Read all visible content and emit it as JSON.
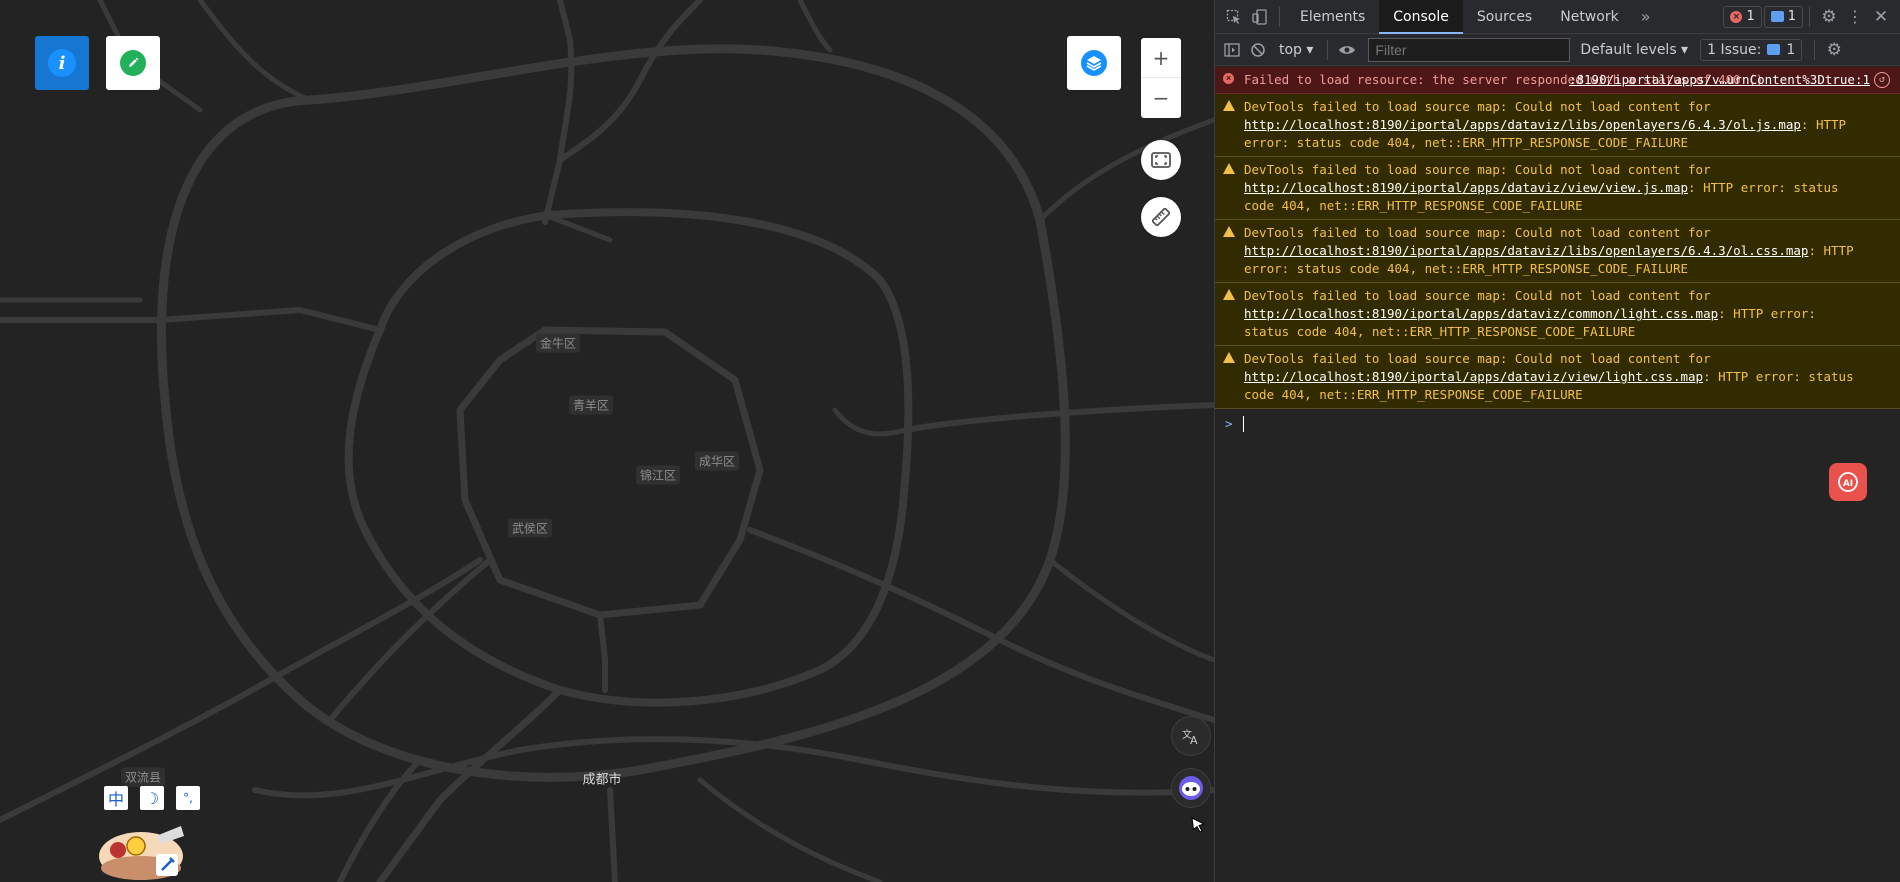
{
  "map": {
    "districts": [
      {
        "id": "jinniu",
        "label": "金牛区"
      },
      {
        "id": "qingyang",
        "label": "青羊区"
      },
      {
        "id": "chenghua",
        "label": "成华区"
      },
      {
        "id": "jinjiang",
        "label": "锦江区"
      },
      {
        "id": "wuhou",
        "label": "武侯区"
      },
      {
        "id": "shuangliu",
        "label": "双流县"
      }
    ],
    "city_label": "成都市",
    "zoom_in_label": "+",
    "zoom_out_label": "−",
    "ime_keys": [
      "中",
      "☽",
      "°,"
    ]
  },
  "devtools": {
    "tabs": [
      "Elements",
      "Console",
      "Sources",
      "Network"
    ],
    "active_tab": "Console",
    "more_tabs": "»",
    "error_count": "1",
    "message_count": "1",
    "context": "top ▾",
    "filter_placeholder": "Filter",
    "levels": "Default levels ▾",
    "issues_label": "1 Issue:",
    "issues_count": "1",
    "messages": [
      {
        "level": "error",
        "text": "Failed to load resource: the server responded with a status of 400 ()",
        "source": ":8190/iportal/apps/v…urnContent%3Dtrue:1"
      },
      {
        "level": "warning",
        "prefix": "DevTools failed to load source map: Could not load content for ",
        "url": "http://localhost:8190/iportal/apps/dataviz/libs/openlayers/6.4.3/ol.js.map",
        "suffix": ": HTTP error: status code 404, net::ERR_HTTP_RESPONSE_CODE_FAILURE"
      },
      {
        "level": "warning",
        "prefix": "DevTools failed to load source map: Could not load content for ",
        "url": "http://localhost:8190/iportal/apps/dataviz/view/view.js.map",
        "suffix": ": HTTP error: status code 404, net::ERR_HTTP_RESPONSE_CODE_FAILURE"
      },
      {
        "level": "warning",
        "prefix": "DevTools failed to load source map: Could not load content for ",
        "url": "http://localhost:8190/iportal/apps/dataviz/libs/openlayers/6.4.3/ol.css.map",
        "suffix": ": HTTP error: status code 404, net::ERR_HTTP_RESPONSE_CODE_FAILURE"
      },
      {
        "level": "warning",
        "prefix": "DevTools failed to load source map: Could not load content for ",
        "url": "http://localhost:8190/iportal/apps/dataviz/common/light.css.map",
        "suffix": ": HTTP error: status code 404, net::ERR_HTTP_RESPONSE_CODE_FAILURE"
      },
      {
        "level": "warning",
        "prefix": "DevTools failed to load source map: Could not load content for ",
        "url": "http://localhost:8190/iportal/apps/dataviz/view/light.css.map",
        "suffix": ": HTTP error: status code 404, net::ERR_HTTP_RESPONSE_CODE_FAILURE"
      }
    ],
    "prompt_symbol": ">"
  },
  "colors": {
    "map_bg": "#232323",
    "road": "#3b3b3b",
    "error_bg": "#4e1717",
    "warning_bg": "#332b00"
  }
}
